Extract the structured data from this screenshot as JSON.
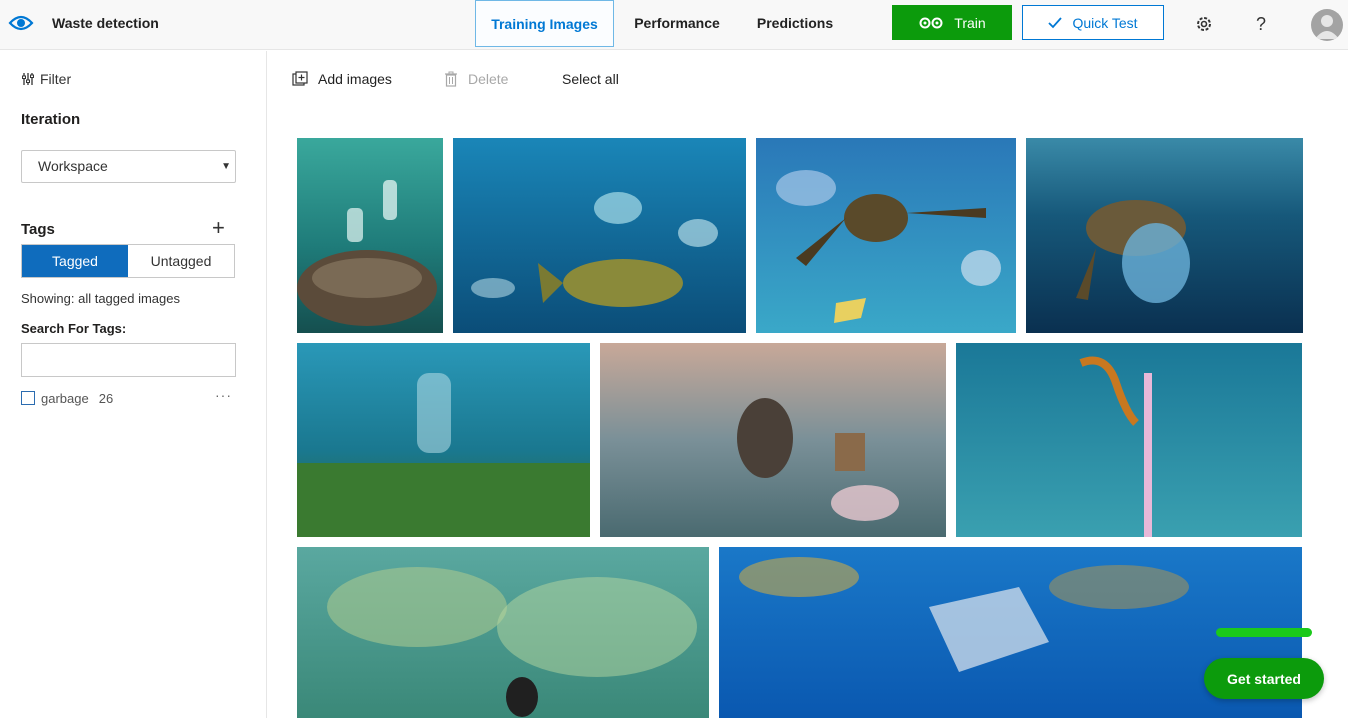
{
  "app": {
    "title": "Waste detection"
  },
  "tabs": [
    {
      "label": "Training Images",
      "active": true
    },
    {
      "label": "Performance",
      "active": false
    },
    {
      "label": "Predictions",
      "active": false
    }
  ],
  "actions": {
    "train_label": "Train",
    "quick_test_label": "Quick Test"
  },
  "colors": {
    "accent": "#0078d4",
    "train_green": "#0c9b0c",
    "tag_selected": "#0f6cbd"
  },
  "icons": {
    "logo": "eye-icon",
    "settings": "gear-icon",
    "help": "question-icon",
    "profile": "avatar-icon"
  },
  "sidebar": {
    "filter_label": "Filter",
    "iteration_heading": "Iteration",
    "iteration_selected": "Workspace",
    "tags_heading": "Tags",
    "toggle": {
      "tagged": "Tagged",
      "untagged": "Untagged",
      "selected": "Tagged"
    },
    "showing_text": "Showing: all tagged images",
    "search_heading": "Search For Tags:",
    "search_value": "",
    "tags": [
      {
        "name": "garbage",
        "count": "26",
        "checked": false
      }
    ]
  },
  "toolbar": {
    "add_images": "Add images",
    "delete": "Delete",
    "select_all": "Select all"
  },
  "images": [
    {
      "description": "underwater coral with plastic bottle"
    },
    {
      "description": "fish swimming among plastic bags"
    },
    {
      "description": "sea turtle eating plastic"
    },
    {
      "description": "sea turtle near plastic bag"
    },
    {
      "description": "plastic bottle over seagrass"
    },
    {
      "description": "diver collecting plastic"
    },
    {
      "description": "seahorse holding cotton swab"
    },
    {
      "description": "diver amid floating debris"
    },
    {
      "description": "plastic bags drifting in blue water"
    }
  ],
  "get_started_label": "Get started"
}
